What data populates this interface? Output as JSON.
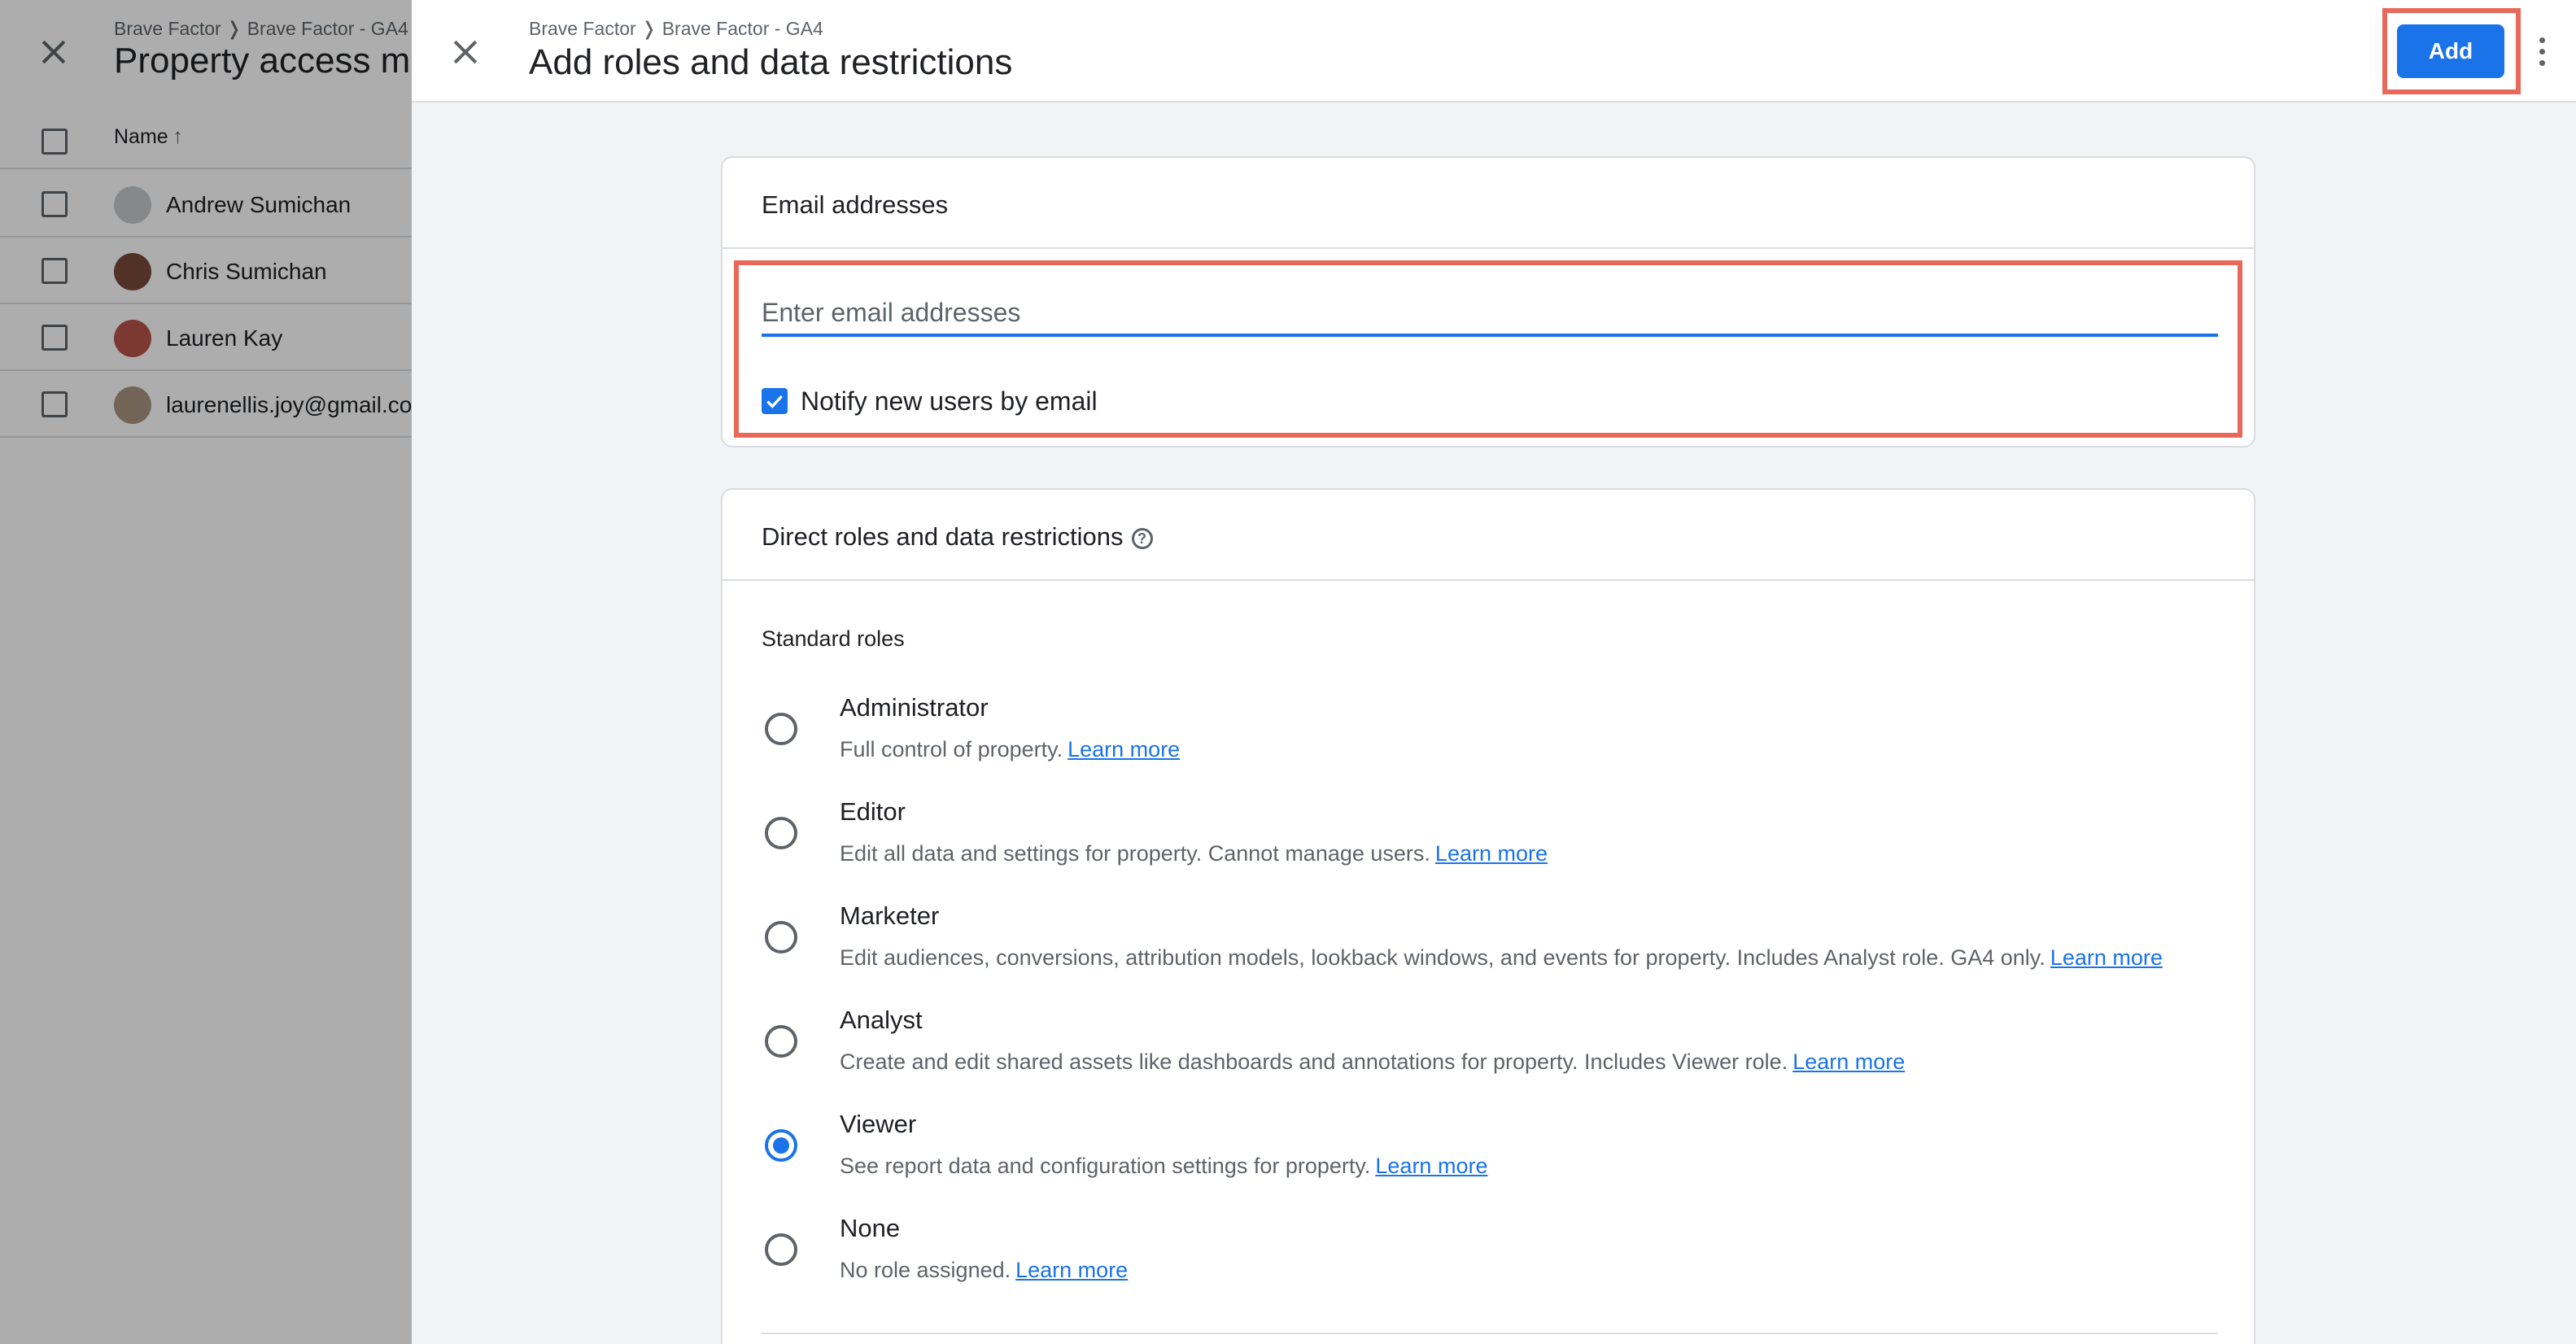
{
  "background": {
    "breadcrumb": "Brave Factor ❭ Brave Factor - GA4",
    "title": "Property access m",
    "table_header_name": "Name",
    "rows": [
      {
        "name": "Andrew Sumichan",
        "avatar_color": "#c7c9cc"
      },
      {
        "name": "Chris Sumichan",
        "avatar_color": "#7a4a3a"
      },
      {
        "name": "Lauren Kay",
        "avatar_color": "#b5544a"
      },
      {
        "name": "laurenellis.joy@gmail.co",
        "avatar_color": "#a89580"
      }
    ]
  },
  "drawer": {
    "breadcrumb": "Brave Factor ❭ Brave Factor - GA4",
    "title": "Add roles and data restrictions",
    "add_button": "Add"
  },
  "email_section": {
    "title": "Email addresses",
    "placeholder": "Enter email addresses",
    "value": "",
    "notify_label": "Notify new users by email",
    "notify_checked": true
  },
  "roles_section": {
    "title": "Direct roles and data restrictions",
    "standard_roles_label": "Standard roles",
    "selected_role": "Viewer",
    "roles": [
      {
        "name": "Administrator",
        "description": "Full control of property.",
        "link": "Learn more"
      },
      {
        "name": "Editor",
        "description": "Edit all data and settings for property. Cannot manage users.",
        "link": "Learn more"
      },
      {
        "name": "Marketer",
        "description": "Edit audiences, conversions, attribution models, lookback windows, and events for property. Includes Analyst role. GA4 only.",
        "link": "Learn more"
      },
      {
        "name": "Analyst",
        "description": "Create and edit shared assets like dashboards and annotations for property. Includes Viewer role.",
        "link": "Learn more"
      },
      {
        "name": "Viewer",
        "description": "See report data and configuration settings for property.",
        "link": "Learn more"
      },
      {
        "name": "None",
        "description": "No role assigned.",
        "link": "Learn more"
      }
    ]
  },
  "colors": {
    "accent": "#1a73e8",
    "highlight": "#e8695a"
  }
}
